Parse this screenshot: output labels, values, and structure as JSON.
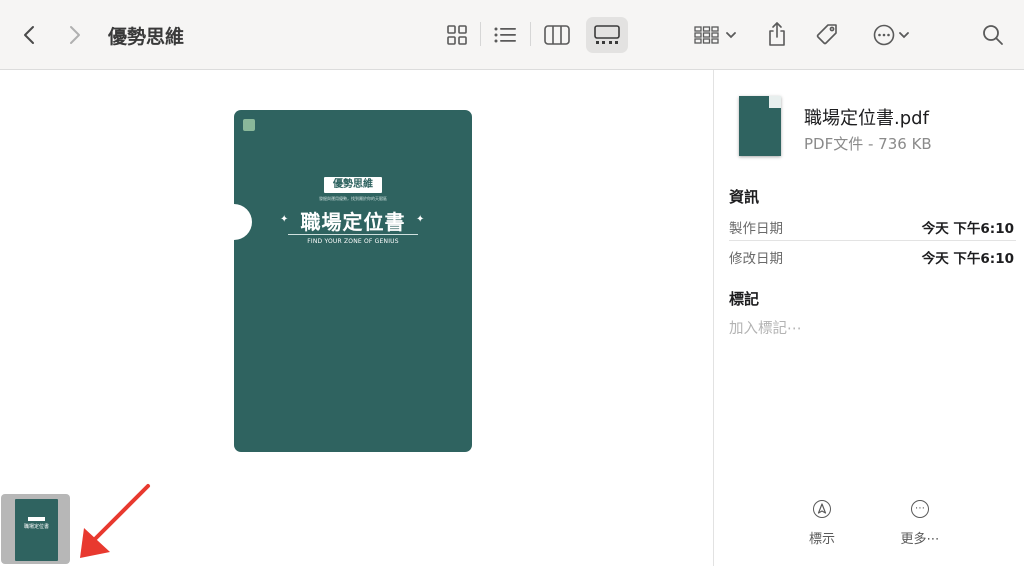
{
  "window": {
    "title": "優勢思維"
  },
  "toolbar": {
    "back_icon": "chevron-left-icon",
    "forward_icon": "chevron-right-icon",
    "views": [
      "icon-view-icon",
      "list-view-icon",
      "column-view-icon",
      "gallery-view-icon"
    ],
    "active_view": "gallery-view-icon",
    "tools": [
      "group-by-icon",
      "share-icon",
      "tag-icon",
      "more-actions-icon",
      "search-icon"
    ]
  },
  "preview": {
    "cover": {
      "tag": "優勢思維",
      "subtitle": "發掘與運用優勢，找到屬於你的天賦區",
      "title": "職場定位書",
      "english": "FIND YOUR ZONE OF GENIUS",
      "color": "#2f6360"
    },
    "thumbnail": {
      "title": "職場定位書"
    }
  },
  "inspector": {
    "file_name": "職場定位書.pdf",
    "file_meta": "PDF文件 - 736 KB",
    "info_heading": "資訊",
    "rows": [
      {
        "label": "製作日期",
        "value": "今天 下午6:10"
      },
      {
        "label": "修改日期",
        "value": "今天 下午6:10"
      }
    ],
    "tags_heading": "標記",
    "tags_placeholder": "加入標記⋯",
    "actions": [
      {
        "label": "標示",
        "icon": "markup-icon"
      },
      {
        "label": "更多⋯",
        "icon": "more-icon"
      }
    ]
  },
  "colors": {
    "accent_arrow": "#e8392f",
    "toolbar_bg": "#f6f5f4"
  }
}
